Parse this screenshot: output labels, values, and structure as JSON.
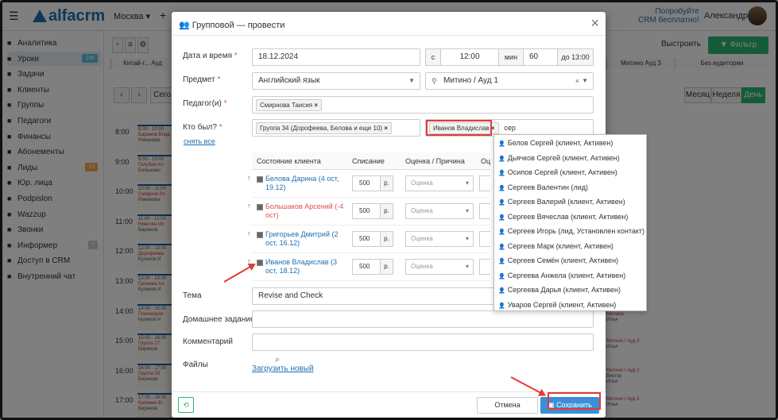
{
  "topbar": {
    "menu_icon": "hamburger-icon",
    "logo": "alfacrm",
    "city": "Москва ▾",
    "plus": "+",
    "promo_line1": "Попробуйте",
    "promo_line2": "CRM бесплатно!",
    "user": "Александра"
  },
  "sidebar": {
    "items": [
      {
        "icon": "chart-icon",
        "label": "Аналитика"
      },
      {
        "icon": "lesson-icon",
        "label": "Уроки",
        "badge": "106",
        "badge_color": "#5bc0de"
      },
      {
        "icon": "tasks-icon",
        "label": "Задачи"
      },
      {
        "icon": "clients-icon",
        "label": "Клиенты"
      },
      {
        "icon": "groups-icon",
        "label": "Группы"
      },
      {
        "icon": "teachers-icon",
        "label": "Педагоги"
      },
      {
        "icon": "finance-icon",
        "label": "Финансы"
      },
      {
        "icon": "subscriptions-icon",
        "label": "Абонементы"
      },
      {
        "icon": "leads-icon",
        "label": "Лиды",
        "badge": "23",
        "badge_color": "#f0ad4e"
      },
      {
        "icon": "legal-icon",
        "label": "Юр. лица"
      },
      {
        "icon": "podpislon-icon",
        "label": "Podpislon"
      },
      {
        "icon": "wazzup-icon",
        "label": "Wazzup"
      },
      {
        "icon": "calls-icon",
        "label": "Звонки"
      },
      {
        "icon": "informer-icon",
        "label": "Информер",
        "badge": "5",
        "badge_color": "#ccc"
      },
      {
        "icon": "lock-icon",
        "label": "Доступ в CRM"
      },
      {
        "icon": "chat-icon",
        "label": "Внутренний чат"
      }
    ]
  },
  "background": {
    "toolbar": {
      "today": "Сего",
      "view_month": "Месяц",
      "view_week": "Неделя",
      "view_day": "День",
      "filter": "Фильтр",
      "hide_label": "Выстроить"
    },
    "rooms": [
      "Китай-г... Ауд",
      "Митино Ауд 3",
      "Без аудитории"
    ],
    "times": [
      "8:00",
      "9:00",
      "10:00",
      "11:00",
      "12:00",
      "13:00",
      "14:00",
      "15:00",
      "16:00",
      "17:00"
    ],
    "events": [
      {
        "l1": "8:00 - 10:00",
        "l2": "Баранов Влад",
        "l3": "Романова"
      },
      {
        "l1": "9:00 - 10:00",
        "l2": "Голубев Ил",
        "l3": "Большако"
      },
      {
        "l1": "10:00 - 11:00",
        "l2": "Смирнов Ро",
        "l3": "Романова"
      },
      {
        "l1": "11:00 - 12:00",
        "l2": "Никитин Ил",
        "l3": "Бирюков"
      },
      {
        "l1": "12:00 - 13:00",
        "l2": "Дорофеева",
        "l3": "Куликов И"
      },
      {
        "l1": "13:00 - 14:00",
        "l2": "Громова Ал",
        "l3": "Куликов И"
      },
      {
        "l1": "14:00 - 15:00",
        "l2": "Пономарёв",
        "l3": "Куликов И"
      },
      {
        "l1": "15:00 - 16:00",
        "l2": "Группа 27",
        "l3": "Бирюков"
      },
      {
        "l1": "16:00 - 17:00",
        "l2": "Группа 33",
        "l3": "Бирюков"
      },
      {
        "l1": "17:00 - 18:00",
        "l2": "Калинин Ег",
        "l3": "Бирюков"
      }
    ],
    "right_events": [
      {
        "l1": "Милана",
        "l2": "Илья"
      },
      {
        "l1": "Митино / Ауд 3",
        "l2": "Илья"
      },
      {
        "l1": "Митино / Ауд 3",
        "l2": "Виктор",
        "l3": "Илья"
      },
      {
        "l1": "Митино / Ауд 3",
        "l2": "Илья"
      }
    ]
  },
  "modal": {
    "title": "Групповой — провести",
    "title_icon": "group-icon",
    "close": "×",
    "datetime_label": "Дата и время",
    "date": "18.12.2024",
    "from_addon": "с",
    "time_from": "12:00",
    "min_addon": "мин",
    "duration": "60",
    "to_addon": "до 13:00",
    "subject_label": "Предмет",
    "subject": "Английский язык",
    "location": "Митино / Ауд 1",
    "teacher_label": "Педагог(и)",
    "teacher_tag": "Смирнова Таисия",
    "who_label": "Кто был?",
    "unselect_all": "снять все",
    "group_tag": "Группа 34 (Дорофеева, Белова и еще 10)",
    "student_tag": "Иванов Владислав",
    "search_value": "сер",
    "table": {
      "col_status": "Состояние клиента",
      "col_charge": "Списание",
      "col_rating": "Оценка / Причина",
      "col_extra": "Оц",
      "rows": [
        {
          "name": "Белова Дарина (4 ост, 19.12)",
          "color": "#1f6fb2",
          "sum": "500",
          "cur": "р.",
          "rating": "Оценка"
        },
        {
          "name": "Большаков Арсений (-4 ост)",
          "color": "#d9534f",
          "sum": "500",
          "cur": "р.",
          "rating": "Оценка"
        },
        {
          "name": "Григорьев Дмитрий (2 ост, 16.12)",
          "color": "#1f6fb2",
          "sum": "500",
          "cur": "р.",
          "rating": "Оценка"
        },
        {
          "name": "Иванов Владислав (3 ост, 18.12)",
          "color": "#1f6fb2",
          "sum": "500",
          "cur": "р.",
          "rating": "Оценка"
        }
      ]
    },
    "topic_label": "Тема",
    "topic": "Revise and Check",
    "homework_label": "Домашнее задание",
    "comment_label": "Комментарий",
    "files_label": "Файлы",
    "upload": "Загрузить новый",
    "cancel": "Отмена",
    "save": "Сохранить"
  },
  "dropdown": {
    "items": [
      "Белов Сергей (клиент, Активен)",
      "Дьячков Сергей (клиент, Активен)",
      "Осипов Сергей (клиент, Активен)",
      "Сергеев Валентин (лид)",
      "Сергеев Валерий (клиент, Активен)",
      "Сергеев Вячеслав (клиент, Активен)",
      "Сергеев Игорь (лид, Установлен контакт)",
      "Сергеев Марк (клиент, Активен)",
      "Сергеев Семён (клиент, Активен)",
      "Сергеева Анжела (клиент, Активен)",
      "Сергеева Дарья (клиент, Активен)",
      "Уваров Сергей (клиент, Активен)"
    ]
  },
  "annotation_color": "#e53935"
}
